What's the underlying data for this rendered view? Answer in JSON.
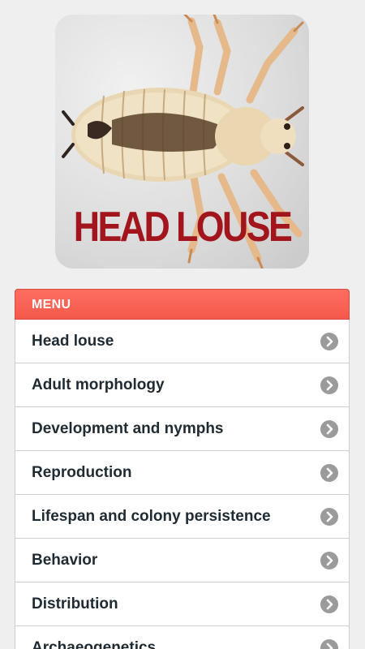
{
  "hero": {
    "title": "HEAD LOUSE",
    "image_icon": "head-louse-photo"
  },
  "menu": {
    "header": "MENU",
    "items": [
      {
        "label": "Head louse",
        "icon": "chevron-right-circle-icon"
      },
      {
        "label": "Adult morphology",
        "icon": "chevron-right-circle-icon"
      },
      {
        "label": "Development and nymphs",
        "icon": "chevron-right-circle-icon"
      },
      {
        "label": "Reproduction",
        "icon": "chevron-right-circle-icon"
      },
      {
        "label": "Lifespan and colony persistence",
        "icon": "chevron-right-circle-icon"
      },
      {
        "label": "Behavior",
        "icon": "chevron-right-circle-icon"
      },
      {
        "label": "Distribution",
        "icon": "chevron-right-circle-icon"
      },
      {
        "label": "Archaeogenetics",
        "icon": "chevron-right-circle-icon"
      }
    ]
  },
  "colors": {
    "background": "#efefef",
    "menu_header": "#f4594b",
    "title_red": "#a3151c",
    "chevron": "#9b9b9b"
  }
}
